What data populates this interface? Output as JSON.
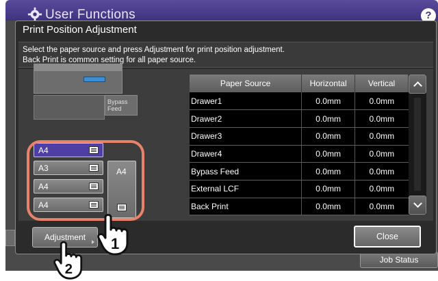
{
  "app": {
    "title": "User Functions"
  },
  "dialog": {
    "title": "Print Position Adjustment",
    "instruction_1": "Select the paper source and press Adjustment for print position adjustment.",
    "instruction_2": "Back Print is common setting for all paper source."
  },
  "printer": {
    "bypass_label_line1": "Bypass",
    "bypass_label_line2": "Feed",
    "drawers": [
      {
        "label": "A4",
        "selected": true
      },
      {
        "label": "A3",
        "selected": false
      },
      {
        "label": "A4",
        "selected": false
      },
      {
        "label": "A4",
        "selected": false
      }
    ],
    "lcf_label": "A4"
  },
  "table": {
    "headers": [
      "Paper Source",
      "Horizontal",
      "Vertical"
    ],
    "rows": [
      [
        "Drawer1",
        "0.0mm",
        "0.0mm"
      ],
      [
        "Drawer2",
        "0.0mm",
        "0.0mm"
      ],
      [
        "Drawer3",
        "0.0mm",
        "0.0mm"
      ],
      [
        "Drawer4",
        "0.0mm",
        "0.0mm"
      ],
      [
        "Bypass Feed",
        "0.0mm",
        "0.0mm"
      ],
      [
        "External LCF",
        "0.0mm",
        "0.0mm"
      ],
      [
        "Back Print",
        "0.0mm",
        "0.0mm"
      ]
    ]
  },
  "buttons": {
    "adjustment": "Adjustment",
    "close": "Close",
    "job_status": "Job Status"
  },
  "callouts": {
    "step1": "1",
    "step2": "2"
  },
  "colors": {
    "header": "#3f3380",
    "selected_drawer": "#4d3fa3",
    "highlight": "#e8836b",
    "accent_screen": "#3b8fd9"
  },
  "icons": [
    "gear-icon",
    "help-icon",
    "paper-tray-icon",
    "chevron-up-icon",
    "chevron-down-icon",
    "hand-pointer-icon"
  ]
}
